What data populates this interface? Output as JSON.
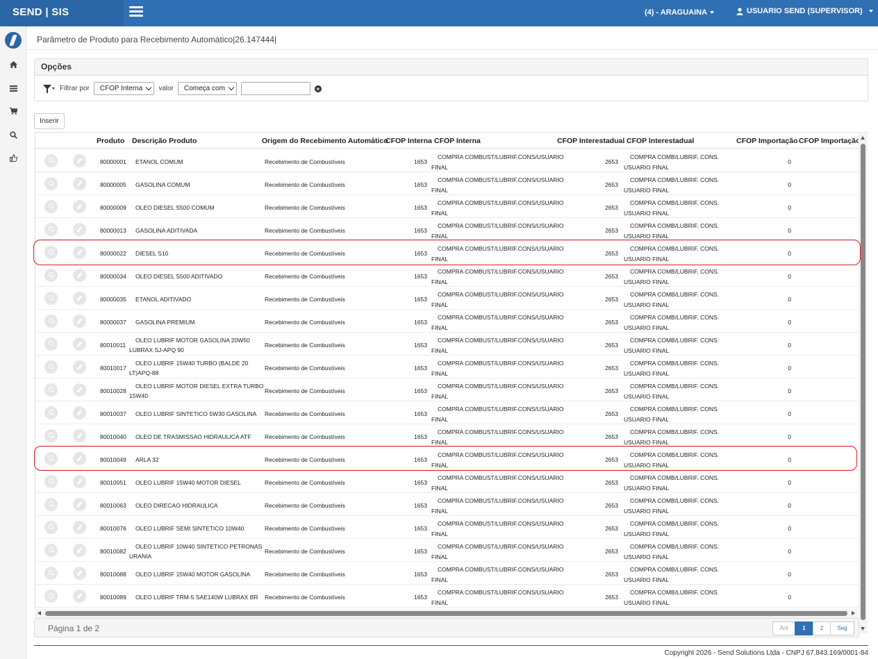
{
  "header": {
    "brand": "SEND | SIS",
    "unit": "(4) - ARAGUAINA",
    "user": "USUARIO SEND (SUPERVISOR)"
  },
  "page": {
    "title": "Parâmetro de Produto para Recebimento Automático|26.147444|"
  },
  "options": {
    "title": "Opções",
    "filter_label": "Filtrar por",
    "filter_field": "CFOP Interna",
    "value_label": "valor",
    "match_mode": "Começa com",
    "value": ""
  },
  "toolbar": {
    "insert_label": "Inserir"
  },
  "table": {
    "columns": {
      "produto": "Produto",
      "descricao": "Descrição Produto",
      "origem": "Origem do Recebimento Automático",
      "cfop_interna": "CFOP Interna",
      "cfop_interna_desc": "CFOP Interna",
      "cfop_interestadual": "CFOP Interestadual",
      "cfop_interestadual_desc": "CFOP Interestadual",
      "cfop_importacao": "CFOP Importação",
      "cfop_importacao_desc": "CFOP Importação"
    },
    "rows": [
      {
        "produto": "80000001",
        "desc1": "ETANOL COMUM",
        "desc2": "",
        "origem": "Recebimento de Combustíveis",
        "cfi": "1653",
        "cfid1": "COMPRA COMBUST/LUBRIF.CONS/USUARIO",
        "cfid2": "FINAL",
        "cfe": "2653",
        "cfed1": "COMPRA COMB/LUBRIF. CONS.",
        "cfed2": "USUARIO FINAL",
        "imp": "0"
      },
      {
        "produto": "80000005",
        "desc1": "GASOLINA COMUM",
        "desc2": "",
        "origem": "Recebimento de Combustíveis",
        "cfi": "1653",
        "cfid1": "COMPRA COMBUST/LUBRIF.CONS/USUARIO",
        "cfid2": "FINAL",
        "cfe": "2653",
        "cfed1": "COMPRA COMB/LUBRIF. CONS.",
        "cfed2": "USUARIO FINAL",
        "imp": "0"
      },
      {
        "produto": "80000009",
        "desc1": "OLEO DIESEL S500 COMUM",
        "desc2": "",
        "origem": "Recebimento de Combustíveis",
        "cfi": "1653",
        "cfid1": "COMPRA COMBUST/LUBRIF.CONS/USUARIO",
        "cfid2": "FINAL",
        "cfe": "2653",
        "cfed1": "COMPRA COMB/LUBRIF. CONS.",
        "cfed2": "USUARIO FINAL",
        "imp": "0"
      },
      {
        "produto": "80000013",
        "desc1": "GASOLINA ADITIVADA",
        "desc2": "",
        "origem": "Recebimento de Combustíveis",
        "cfi": "1653",
        "cfid1": "COMPRA COMBUST/LUBRIF.CONS/USUARIO",
        "cfid2": "FINAL",
        "cfe": "2653",
        "cfed1": "COMPRA COMB/LUBRIF. CONS.",
        "cfed2": "USUARIO FINAL",
        "imp": "0"
      },
      {
        "produto": "80000022",
        "desc1": "DIESEL S10",
        "desc2": "",
        "origem": "Recebimento de Combustíveis",
        "cfi": "1653",
        "cfid1": "COMPRA COMBUST/LUBRIF.CONS/USUARIO",
        "cfid2": "FINAL",
        "cfe": "2653",
        "cfed1": "COMPRA COMB/LUBRIF. CONS.",
        "cfed2": "USUARIO FINAL",
        "imp": "0"
      },
      {
        "produto": "80000034",
        "desc1": "OLEO DIESEL S500 ADITIVADO",
        "desc2": "",
        "origem": "Recebimento de Combustíveis",
        "cfi": "1653",
        "cfid1": "COMPRA COMBUST/LUBRIF.CONS/USUARIO",
        "cfid2": "FINAL",
        "cfe": "2653",
        "cfed1": "COMPRA COMB/LUBRIF. CONS.",
        "cfed2": "USUARIO FINAL",
        "imp": "0"
      },
      {
        "produto": "80000035",
        "desc1": "ETANOL ADITIVADO",
        "desc2": "",
        "origem": "Recebimento de Combustíveis",
        "cfi": "1653",
        "cfid1": "COMPRA COMBUST/LUBRIF.CONS/USUARIO",
        "cfid2": "FINAL",
        "cfe": "2653",
        "cfed1": "COMPRA COMB/LUBRIF. CONS.",
        "cfed2": "USUARIO FINAL",
        "imp": "0"
      },
      {
        "produto": "80000037",
        "desc1": "GASOLINA PREMIUM",
        "desc2": "",
        "origem": "Recebimento de Combustíveis",
        "cfi": "1653",
        "cfid1": "COMPRA COMBUST/LUBRIF.CONS/USUARIO",
        "cfid2": "FINAL",
        "cfe": "2653",
        "cfed1": "COMPRA COMB/LUBRIF. CONS.",
        "cfed2": "USUARIO FINAL",
        "imp": "0"
      },
      {
        "produto": "80010011",
        "desc1": "OLEO LUBRIF MOTOR GASOLINA 20W50",
        "desc2": "LUBRAX SJ-APQ 90",
        "origem": "Recebimento de Combustíveis",
        "cfi": "1653",
        "cfid1": "COMPRA COMBUST/LUBRIF.CONS/USUARIO",
        "cfid2": "FINAL",
        "cfe": "2653",
        "cfed1": "COMPRA COMB/LUBRIF. CONS.",
        "cfed2": "USUARIO FINAL",
        "imp": "0"
      },
      {
        "produto": "80010017",
        "desc1": "OLEO LUBRIF 15W40 TURBO (BALDE 20",
        "desc2": "LT)APQ-88",
        "origem": "Recebimento de Combustíveis",
        "cfi": "1653",
        "cfid1": "COMPRA COMBUST/LUBRIF.CONS/USUARIO",
        "cfid2": "FINAL",
        "cfe": "2653",
        "cfed1": "COMPRA COMB/LUBRIF. CONS.",
        "cfed2": "USUARIO FINAL",
        "imp": "0"
      },
      {
        "produto": "80010028",
        "desc1": "OLEO LUBRIF MOTOR DIESEL EXTRA TURBO",
        "desc2": "15W40",
        "origem": "Recebimento de Combustíveis",
        "cfi": "1653",
        "cfid1": "COMPRA COMBUST/LUBRIF.CONS/USUARIO",
        "cfid2": "FINAL",
        "cfe": "2653",
        "cfed1": "COMPRA COMB/LUBRIF. CONS.",
        "cfed2": "USUARIO FINAL",
        "imp": "0"
      },
      {
        "produto": "80010037",
        "desc1": "OLEO LUBRIF SINTETICO 5W30 GASOLINA",
        "desc2": "",
        "origem": "Recebimento de Combustíveis",
        "cfi": "1653",
        "cfid1": "COMPRA COMBUST/LUBRIF.CONS/USUARIO",
        "cfid2": "FINAL",
        "cfe": "2653",
        "cfed1": "COMPRA COMB/LUBRIF. CONS.",
        "cfed2": "USUARIO FINAL",
        "imp": "0"
      },
      {
        "produto": "80010040",
        "desc1": "OLEO DE TRASMISSAO HIDRAULICA ATF",
        "desc2": "",
        "origem": "Recebimento de Combustíveis",
        "cfi": "1653",
        "cfid1": "COMPRA COMBUST/LUBRIF.CONS/USUARIO",
        "cfid2": "FINAL",
        "cfe": "2653",
        "cfed1": "COMPRA COMB/LUBRIF. CONS.",
        "cfed2": "USUARIO FINAL",
        "imp": "0"
      },
      {
        "produto": "80010049",
        "desc1": "ARLA 32",
        "desc2": "",
        "origem": "Recebimento de Combustíveis",
        "cfi": "1653",
        "cfid1": "COMPRA COMBUST/LUBRIF.CONS/USUARIO",
        "cfid2": "FINAL",
        "cfe": "2653",
        "cfed1": "COMPRA COMB/LUBRIF. CONS.",
        "cfed2": "USUARIO FINAL",
        "imp": "0"
      },
      {
        "produto": "80010051",
        "desc1": "OLEO LUBRIF 15W40 MOTOR DIESEL",
        "desc2": "",
        "origem": "Recebimento de Combustíveis",
        "cfi": "1653",
        "cfid1": "COMPRA COMBUST/LUBRIF.CONS/USUARIO",
        "cfid2": "FINAL",
        "cfe": "2653",
        "cfed1": "COMPRA COMB/LUBRIF. CONS.",
        "cfed2": "USUARIO FINAL",
        "imp": "0"
      },
      {
        "produto": "80010063",
        "desc1": "OLEO DIRECAO HIDRAULICA",
        "desc2": "",
        "origem": "Recebimento de Combustíveis",
        "cfi": "1653",
        "cfid1": "COMPRA COMBUST/LUBRIF.CONS/USUARIO",
        "cfid2": "FINAL",
        "cfe": "2653",
        "cfed1": "COMPRA COMB/LUBRIF. CONS.",
        "cfed2": "USUARIO FINAL",
        "imp": "0"
      },
      {
        "produto": "80010076",
        "desc1": "OLEO LUBRIF SEMI SINTETICO 10W40",
        "desc2": "",
        "origem": "Recebimento de Combustíveis",
        "cfi": "1653",
        "cfid1": "COMPRA COMBUST/LUBRIF.CONS/USUARIO",
        "cfid2": "FINAL",
        "cfe": "2653",
        "cfed1": "COMPRA COMB/LUBRIF. CONS.",
        "cfed2": "USUARIO FINAL",
        "imp": "0"
      },
      {
        "produto": "80010082",
        "desc1": "OLEO LUBRIF 10W40 SINTETICO PETRONAS",
        "desc2": "URANIA",
        "origem": "Recebimento de Combustíveis",
        "cfi": "1653",
        "cfid1": "COMPRA COMBUST/LUBRIF.CONS/USUARIO",
        "cfid2": "FINAL",
        "cfe": "2653",
        "cfed1": "COMPRA COMB/LUBRIF. CONS.",
        "cfed2": "USUARIO FINAL",
        "imp": "0"
      },
      {
        "produto": "80010088",
        "desc1": "OLEO LUBRIF 15W40 MOTOR GASOLINA",
        "desc2": "",
        "origem": "Recebimento de Combustíveis",
        "cfi": "1653",
        "cfid1": "COMPRA COMBUST/LUBRIF.CONS/USUARIO",
        "cfid2": "FINAL",
        "cfe": "2653",
        "cfed1": "COMPRA COMB/LUBRIF. CONS.",
        "cfed2": "USUARIO FINAL",
        "imp": "0"
      },
      {
        "produto": "80010089",
        "desc1": "OLEO LUBRIF TRM-5 SAE140W LUBRAX BR",
        "desc2": "",
        "origem": "Recebimento de Combustíveis",
        "cfi": "1653",
        "cfid1": "COMPRA COMBUST/LUBRIF.CONS/USUARIO",
        "cfid2": "FINAL",
        "cfe": "2653",
        "cfed1": "COMPRA COMB/LUBRIF. CONS.",
        "cfed2": "USUARIO FINAL",
        "imp": "0"
      }
    ]
  },
  "pagination": {
    "info": "Página 1 de 2",
    "prev": "Ant",
    "pages": [
      "1",
      "2"
    ],
    "next": "Seg"
  },
  "footer": {
    "copyright": "Copyright 2026 - Send Solutions Ltda - CNPJ 67.843.169/0001-84"
  },
  "colors": {
    "header_bg": "#2f6fb3",
    "highlight": "#e21c1c"
  },
  "icons": {
    "sidebar": [
      "home-icon",
      "list-icon",
      "cart-icon",
      "search-icon",
      "thumbs-up-icon"
    ]
  }
}
